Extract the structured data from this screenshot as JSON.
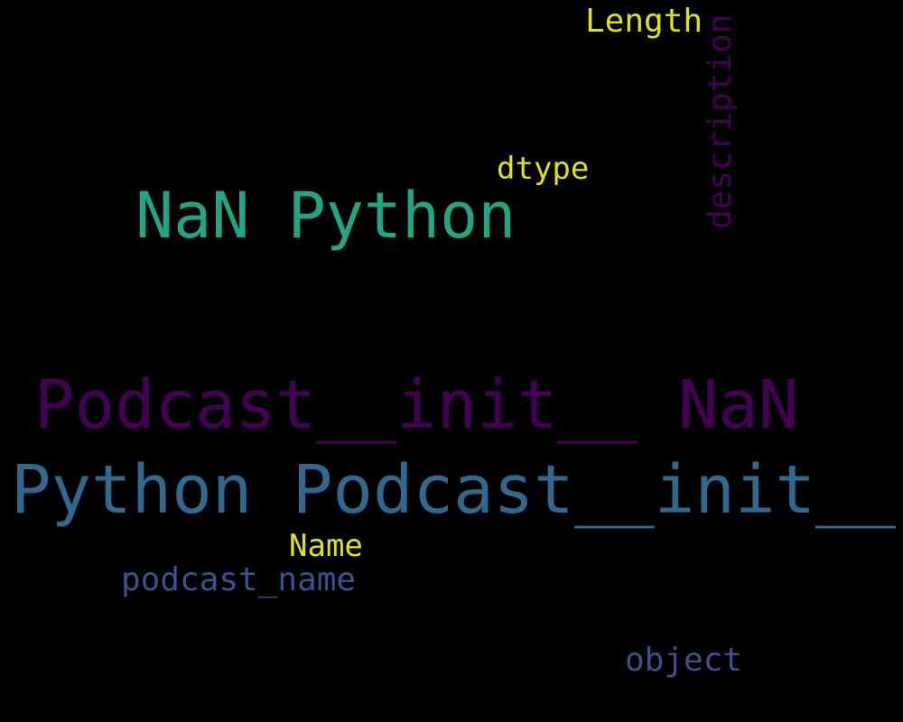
{
  "words": [
    {
      "text": "Python Podcast__init__",
      "color": "#31688e"
    },
    {
      "text": "Podcast__init__ NaN",
      "color": "#440154"
    },
    {
      "text": "NaN Python",
      "color": "#21a585"
    },
    {
      "text": "Length",
      "color": "#dde318"
    },
    {
      "text": "dtype",
      "color": "#dde318"
    },
    {
      "text": "description",
      "color": "#440154"
    },
    {
      "text": "Name",
      "color": "#dde318"
    },
    {
      "text": "podcast_name",
      "color": "#3b528b"
    },
    {
      "text": "object",
      "color": "#3b528b"
    }
  ]
}
